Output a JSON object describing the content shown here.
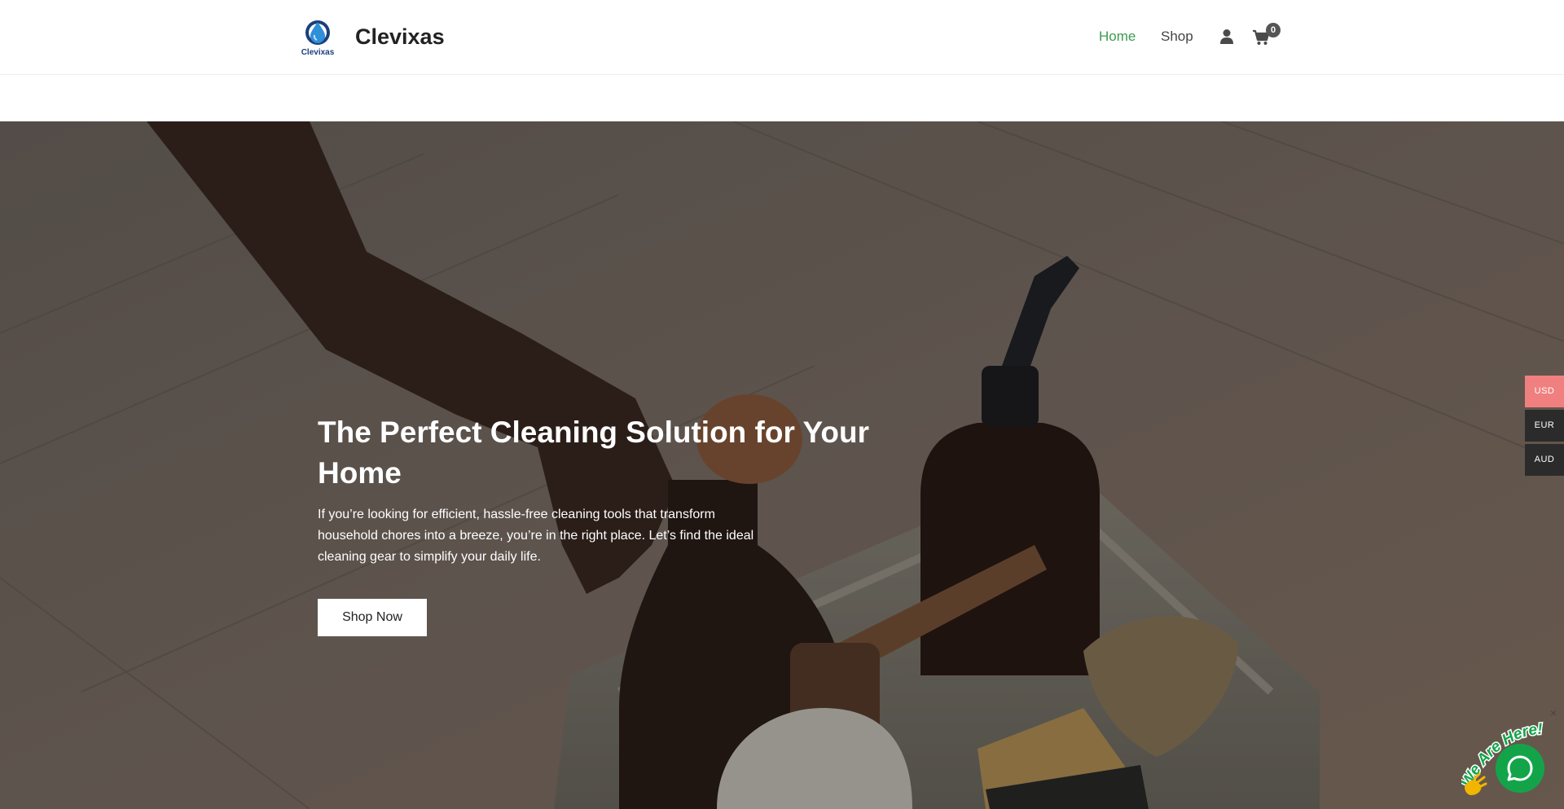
{
  "header": {
    "logo_text": "Clevixas",
    "brand": "Clevixas",
    "nav": [
      {
        "label": "Home",
        "active": true
      },
      {
        "label": "Shop",
        "active": false
      }
    ],
    "icons": [
      "user-icon",
      "cart-icon"
    ],
    "cart_count": "0"
  },
  "hero": {
    "title": "The Perfect Cleaning Solution for Your Home",
    "text": "If you’re looking for efficient, hassle-free cleaning tools that transform household chores into a breeze, you’re in the right place. Let’s find the ideal cleaning gear to simplify your daily life.",
    "button": "Shop Now"
  },
  "currency": {
    "options": [
      "USD",
      "EUR",
      "AUD"
    ],
    "selected": "USD"
  },
  "chat": {
    "badge_text": "We Are Here!",
    "close": "×",
    "icons": [
      "chat-icon",
      "wave-hand-icon",
      "close-icon"
    ]
  },
  "colors": {
    "nav_active": "#3d9a4f",
    "currency_active": "#f08080",
    "currency_inactive": "#2b2b2b",
    "chat": "#13a44a",
    "logo_blue": "#1a5fa8"
  }
}
